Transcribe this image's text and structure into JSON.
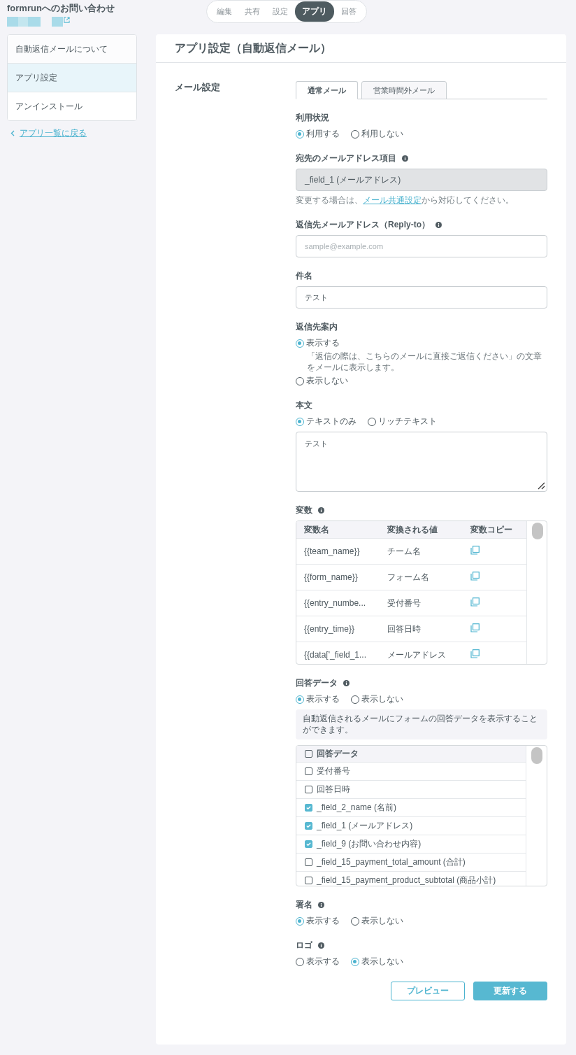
{
  "header": {
    "form_title": "formrunへのお問い合わせ"
  },
  "top_tabs": [
    {
      "label": "編集",
      "selected": false
    },
    {
      "label": "共有",
      "selected": false
    },
    {
      "label": "設定",
      "selected": false
    },
    {
      "label": "アプリ",
      "selected": true
    },
    {
      "label": "回答",
      "selected": false
    }
  ],
  "sidebar": {
    "items": [
      {
        "label": "自動返信メールについて",
        "selected": false
      },
      {
        "label": "アプリ設定",
        "selected": true
      },
      {
        "label": "アンインストール",
        "selected": false
      }
    ],
    "back_link": "アプリ一覧に戻る"
  },
  "page_title": "アプリ設定（自動返信メール）",
  "section_label": "メール設定",
  "mail_tabs": [
    {
      "label": "通常メール",
      "selected": true
    },
    {
      "label": "営業時間外メール",
      "selected": false
    }
  ],
  "fields": [
    {
      "kind": "radio",
      "label": "利用状況",
      "stacked": false,
      "options": [
        {
          "label": "利用する",
          "selected": true
        },
        {
          "label": "利用しない",
          "selected": false
        }
      ]
    },
    {
      "kind": "readonly",
      "label": "宛先のメールアドレス項目",
      "info": true,
      "value": "_field_1 (メールアドレス)",
      "help": {
        "before": "変更する場合は、",
        "link": "メール共通設定",
        "after": "から対応してください。"
      }
    },
    {
      "kind": "input",
      "label": "返信先メールアドレス（Reply-to）",
      "info": true,
      "placeholder": "sample@example.com"
    },
    {
      "kind": "input",
      "label": "件名",
      "value": "テスト"
    },
    {
      "kind": "radio",
      "label": "返信先案内",
      "stacked": true,
      "options": [
        {
          "label": "表示する",
          "selected": true,
          "note": "「返信の際は、こちらのメールに直接ご返信ください」の文章をメールに表示します。"
        },
        {
          "label": "表示しない",
          "selected": false
        }
      ]
    },
    {
      "kind": "radio",
      "label": "本文",
      "stacked": false,
      "options": [
        {
          "label": "テキストのみ",
          "selected": true
        },
        {
          "label": "リッチテキスト",
          "selected": false
        }
      ]
    },
    {
      "kind": "textarea",
      "value": "テスト"
    },
    {
      "kind": "table",
      "label": "変数",
      "info": true,
      "columns": [
        "変数名",
        "変換される値",
        "変数コピー"
      ],
      "rows": [
        {
          "name": "{{team_name}}",
          "value": "チーム名"
        },
        {
          "name": "{{form_name}}",
          "value": "フォーム名"
        },
        {
          "name": "{{entry_numbe...",
          "value": "受付番号"
        },
        {
          "name": "{{entry_time}}",
          "value": "回答日時"
        },
        {
          "name": "{{data['_field_1...",
          "value": "メールアドレス"
        }
      ]
    },
    {
      "kind": "radio",
      "label": "回答データ",
      "info": true,
      "stacked": false,
      "options": [
        {
          "label": "表示する",
          "selected": true
        },
        {
          "label": "表示しない",
          "selected": false
        }
      ]
    },
    {
      "kind": "notice",
      "text": "自動返信されるメールにフォームの回答データを表示することができます。"
    },
    {
      "kind": "checklist",
      "header": {
        "label": "回答データ",
        "checked": false
      },
      "items": [
        {
          "label": "受付番号",
          "checked": false
        },
        {
          "label": "回答日時",
          "checked": false
        },
        {
          "label": "_field_2_name (名前)",
          "checked": true
        },
        {
          "label": "_field_1 (メールアドレス)",
          "checked": true
        },
        {
          "label": "_field_9 (お問い合わせ内容)",
          "checked": true
        },
        {
          "label": "_field_15_payment_total_amount (合計)",
          "checked": false
        },
        {
          "label": "_field_15_payment_product_subtotal (商品小計)",
          "checked": false
        }
      ]
    },
    {
      "kind": "radio",
      "label": "署名",
      "info": true,
      "stacked": false,
      "options": [
        {
          "label": "表示する",
          "selected": true
        },
        {
          "label": "表示しない",
          "selected": false
        }
      ]
    },
    {
      "kind": "radio",
      "label": "ロゴ",
      "info": true,
      "stacked": false,
      "options": [
        {
          "label": "表示する",
          "selected": false
        },
        {
          "label": "表示しない",
          "selected": true
        }
      ]
    }
  ],
  "buttons": {
    "preview": "プレビュー",
    "submit": "更新する"
  }
}
